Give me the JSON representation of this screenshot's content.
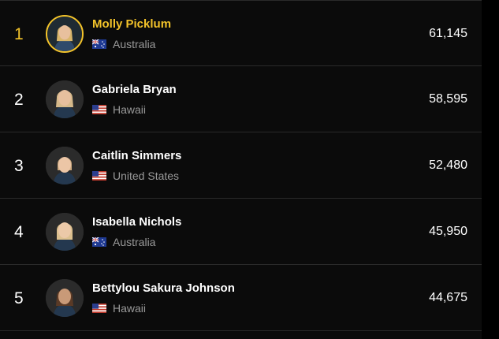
{
  "rankings": [
    {
      "rank": "1",
      "name": "Molly Picklum",
      "country": "Australia",
      "flag": "australia-flag-icon",
      "points": "61,145",
      "leader": true
    },
    {
      "rank": "2",
      "name": "Gabriela Bryan",
      "country": "Hawaii",
      "flag": "us-flag-icon",
      "points": "58,595",
      "leader": false
    },
    {
      "rank": "3",
      "name": "Caitlin Simmers",
      "country": "United States",
      "flag": "us-flag-icon",
      "points": "52,480",
      "leader": false
    },
    {
      "rank": "4",
      "name": "Isabella Nichols",
      "country": "Australia",
      "flag": "australia-flag-icon",
      "points": "45,950",
      "leader": false
    },
    {
      "rank": "5",
      "name": "Bettylou Sakura Johnson",
      "country": "Hawaii",
      "flag": "us-flag-icon",
      "points": "44,675",
      "leader": false
    }
  ],
  "colors": {
    "background": "#0b0b0b",
    "leader_accent": "#f3c32a",
    "text": "#ffffff",
    "muted_text": "#9a9a9a",
    "divider": "#2a2a2a"
  }
}
